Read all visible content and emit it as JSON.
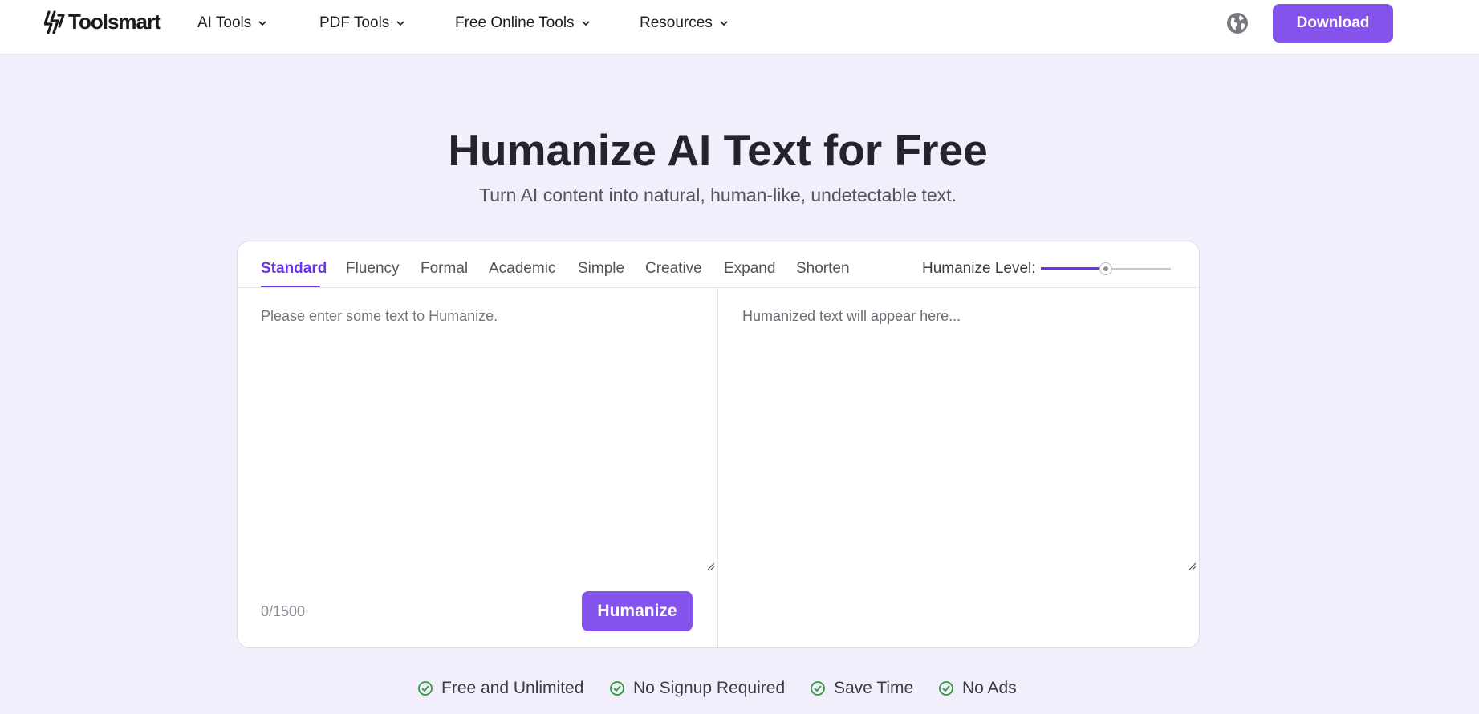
{
  "header": {
    "logo_text": "Toolsmart",
    "nav": [
      {
        "label": "AI Tools"
      },
      {
        "label": "PDF Tools"
      },
      {
        "label": "Free Online Tools"
      },
      {
        "label": "Resources"
      }
    ],
    "download_label": "Download"
  },
  "hero": {
    "title": "Humanize AI Text for Free",
    "subtitle": "Turn AI content into natural, human-like, undetectable text."
  },
  "tool": {
    "tabs": [
      {
        "label": "Standard",
        "active": true
      },
      {
        "label": "Fluency"
      },
      {
        "label": "Formal"
      },
      {
        "label": "Academic"
      },
      {
        "label": "Simple"
      },
      {
        "label": "Creative"
      },
      {
        "label": "Expand"
      },
      {
        "label": "Shorten"
      }
    ],
    "level_label": "Humanize Level:",
    "level_value": 0.5,
    "input_placeholder": "Please enter some text to Humanize.",
    "output_placeholder": "Humanized text will appear here...",
    "counter": "0/1500",
    "humanize_label": "Humanize"
  },
  "features": [
    {
      "label": "Free and Unlimited"
    },
    {
      "label": "No Signup Required"
    },
    {
      "label": "Save Time"
    },
    {
      "label": "No Ads"
    }
  ],
  "colors": {
    "accent": "#8353ec",
    "active_tab": "#6b33e8",
    "page_bg": "#f2eefc",
    "check": "#2e9b3a"
  }
}
